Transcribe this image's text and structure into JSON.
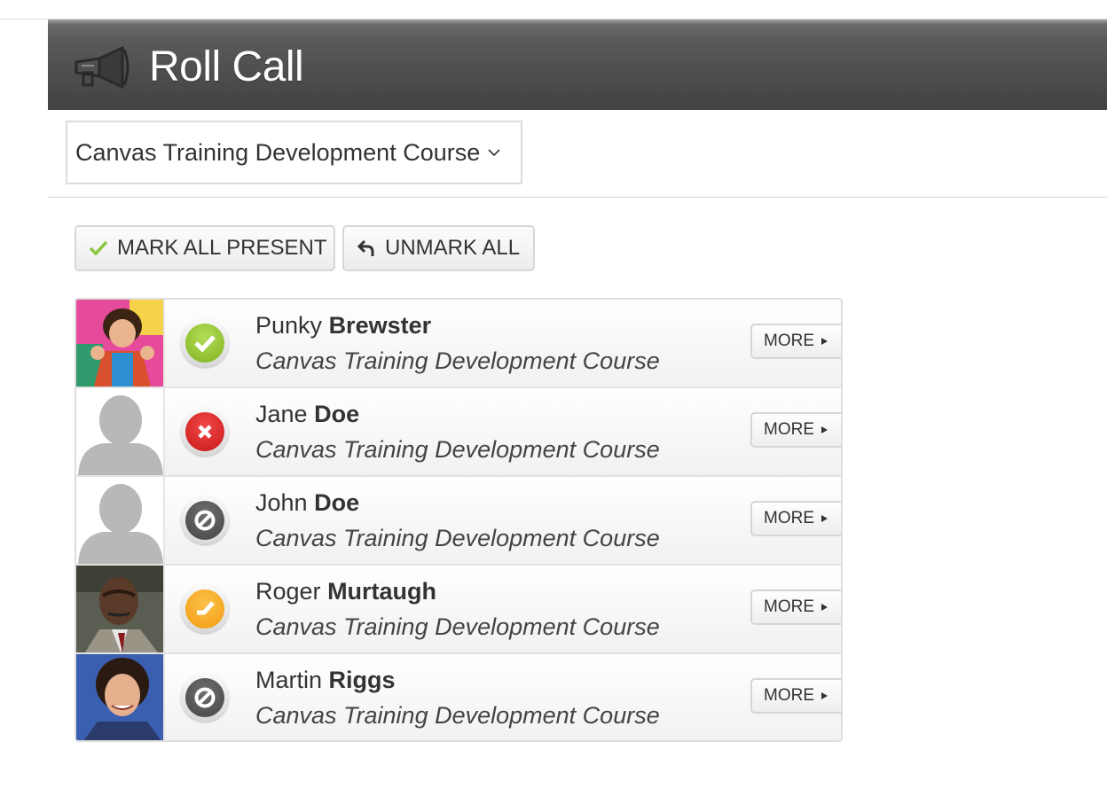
{
  "header": {
    "title": "Roll Call",
    "icon": "megaphone-icon"
  },
  "course_select": {
    "selected": "Canvas Training Development Course"
  },
  "toolbar": {
    "mark_all_label": "MARK ALL PRESENT",
    "unmark_all_label": "UNMARK ALL"
  },
  "students": [
    {
      "first": "Punky",
      "last": "Brewster",
      "course": "Canvas Training Development Course",
      "status": "present",
      "avatar": "photo",
      "more_label": "MORE"
    },
    {
      "first": "Jane",
      "last": "Doe",
      "course": "Canvas Training Development Course",
      "status": "absent",
      "avatar": "placeholder",
      "more_label": "MORE"
    },
    {
      "first": "John",
      "last": "Doe",
      "course": "Canvas Training Development Course",
      "status": "unmarked",
      "avatar": "placeholder",
      "more_label": "MORE"
    },
    {
      "first": "Roger",
      "last": "Murtaugh",
      "course": "Canvas Training Development Course",
      "status": "late",
      "avatar": "photo",
      "more_label": "MORE"
    },
    {
      "first": "Martin",
      "last": "Riggs",
      "course": "Canvas Training Development Course",
      "status": "unmarked",
      "avatar": "photo",
      "more_label": "MORE"
    }
  ],
  "colors": {
    "present": "#8cc63f",
    "absent": "#d91f1f",
    "unmarked": "#555555",
    "late": "#f5a623",
    "header": "#4a4a4a"
  }
}
